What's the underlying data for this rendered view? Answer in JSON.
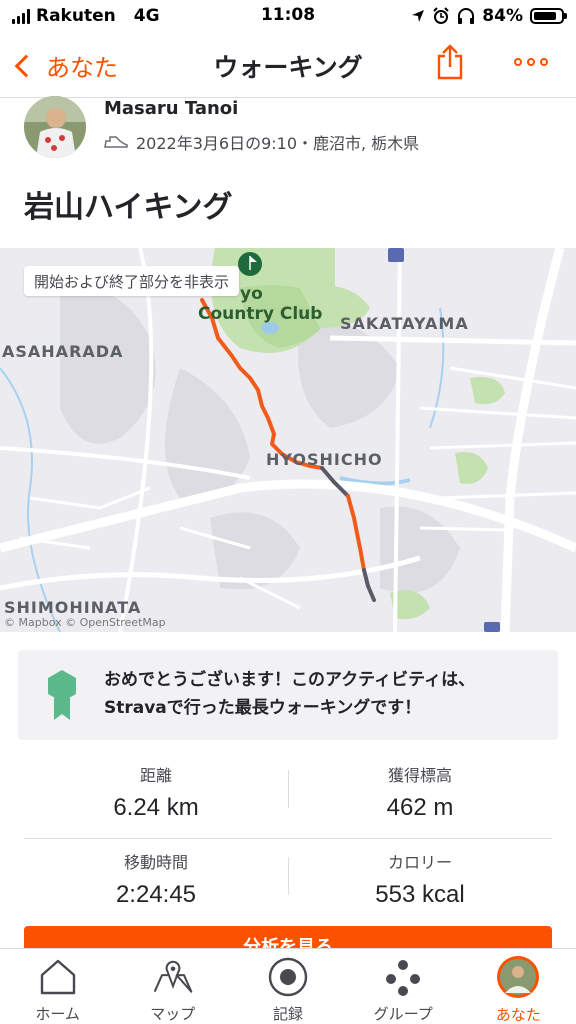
{
  "status_bar": {
    "carrier": "Rakuten",
    "network": "4G",
    "time": "11:08",
    "battery": "84%",
    "battery_level": 0.84
  },
  "nav": {
    "back_label": "あなた",
    "title": "ウォーキング"
  },
  "activity": {
    "athlete_name": "Masaru Tanoi",
    "meta": "2022年3月6日の9:10・鹿沼市, 栃木県",
    "title": "岩山ハイキング"
  },
  "map": {
    "hide_endpoints_button": "開始および終了部分を非表示",
    "labels": {
      "country_club": "Country Club",
      "sakatayama": "SAKATAYAMA",
      "asaharada": "ASAHARADA",
      "hyoshicho": "HYOSHICHO",
      "shimohinata": "SHIMOHINATA",
      "yo": "yo"
    },
    "attribution": "© Mapbox © OpenStreetMap"
  },
  "achievement": {
    "text": "おめでとうございます！このアクティビティは、Stravaで行った最長ウォーキングです！"
  },
  "stats": [
    {
      "label": "距離",
      "value": "6.24 km"
    },
    {
      "label": "獲得標高",
      "value": "462 m"
    },
    {
      "label": "移動時間",
      "value": "2:24:45"
    },
    {
      "label": "カロリー",
      "value": "553 kcal"
    }
  ],
  "analyze_button": "分析を見る",
  "tabs": [
    {
      "label": "ホーム"
    },
    {
      "label": "マップ"
    },
    {
      "label": "記録"
    },
    {
      "label": "グループ"
    },
    {
      "label": "あなた"
    }
  ],
  "colors": {
    "accent": "#fc5200",
    "badge_green": "#5bb98c",
    "route_orange": "#f25a1a",
    "route_gray": "#5a5a66"
  }
}
